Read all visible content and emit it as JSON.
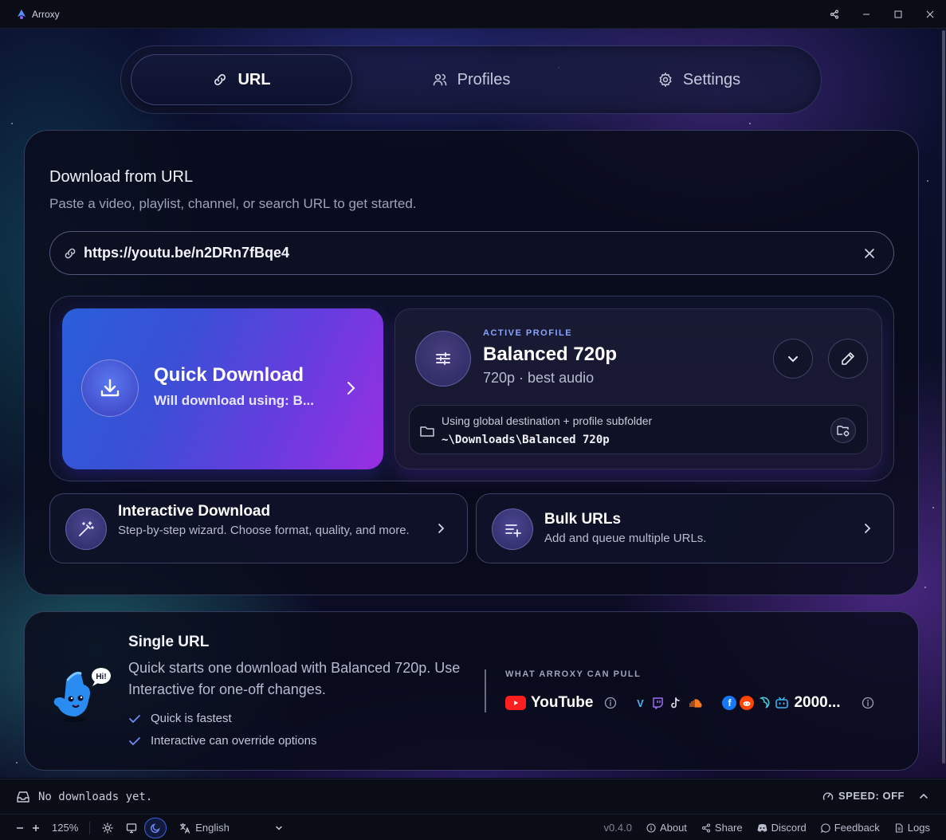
{
  "window": {
    "title": "Arroxy"
  },
  "tabs": [
    {
      "label": "URL",
      "icon": "link-icon",
      "active": true
    },
    {
      "label": "Profiles",
      "icon": "users-icon",
      "active": false
    },
    {
      "label": "Settings",
      "icon": "gear-icon",
      "active": false
    }
  ],
  "download": {
    "title": "Download from URL",
    "subtitle": "Paste a video, playlist, channel, or search URL to get started.",
    "url_value": "https://youtu.be/n2DRn7fBqe4"
  },
  "quick": {
    "title": "Quick Download",
    "subtitle": "Will download using: B..."
  },
  "profile": {
    "eyebrow": "ACTIVE PROFILE",
    "name": "Balanced 720p",
    "meta": "720p · best audio",
    "destination_label": "Using global destination + profile subfolder",
    "destination_path": "~\\Downloads\\Balanced 720p"
  },
  "modes": {
    "interactive": {
      "title": "Interactive Download",
      "subtitle": "Step-by-step wizard. Choose format, quality, and more."
    },
    "bulk": {
      "title": "Bulk URLs",
      "subtitle": "Add and queue multiple URLs."
    }
  },
  "info": {
    "mascot_bubble": "Hi!",
    "title": "Single URL",
    "description": "Quick starts one download with Balanced 720p. Use Interactive for one-off changes.",
    "checks": [
      "Quick is fastest",
      "Interactive can override options"
    ],
    "sources_label": "WHAT ARROXY CAN PULL",
    "primary_source": "YouTube",
    "more_count": "2000..."
  },
  "status": {
    "message": "No downloads yet.",
    "speed": "SPEED: OFF"
  },
  "bottom": {
    "zoom": "125%",
    "language": "English",
    "version": "v0.4.0",
    "links": [
      "About",
      "Share",
      "Discord",
      "Feedback",
      "Logs"
    ]
  },
  "colors": {
    "accent": "#3b4fd6",
    "quick_gradient_end": "#9a2fe2",
    "profile_eyebrow": "#8aa3ff",
    "youtube_red": "#ff1f1f"
  }
}
